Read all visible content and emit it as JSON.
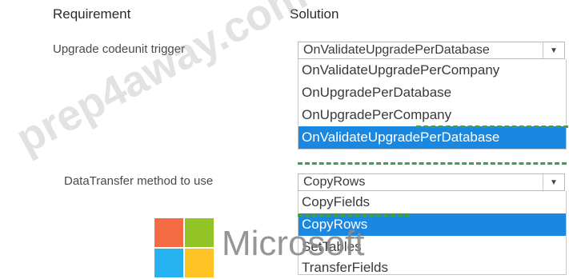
{
  "headers": {
    "requirement": "Requirement",
    "solution": "Solution"
  },
  "trigger_row": {
    "label": "Upgrade codeunit trigger",
    "selected": "OnValidateUpgradePerDatabase",
    "options": [
      "OnValidateUpgradePerCompany",
      "OnUpgradePerDatabase",
      "OnUpgradePerCompany",
      "OnValidateUpgradePerDatabase"
    ],
    "highlighted_index": 3
  },
  "datatransfer_row": {
    "label": "DataTransfer method to use",
    "selected": "CopyRows",
    "options": [
      "CopyFields",
      "CopyRows",
      "SetTables",
      "TransferFields"
    ],
    "highlighted_index": 1
  },
  "watermark": {
    "text": "prep4away.com"
  },
  "logo": {
    "word": "Microsoft"
  },
  "colors": {
    "highlight": "#1a87e0",
    "dash": "#3aa34a",
    "ms_red": "#f25022",
    "ms_green": "#7fba00",
    "ms_blue": "#00a4ef",
    "ms_yellow": "#ffb900"
  },
  "icons": {
    "dropdown": "chevron-down-icon"
  }
}
